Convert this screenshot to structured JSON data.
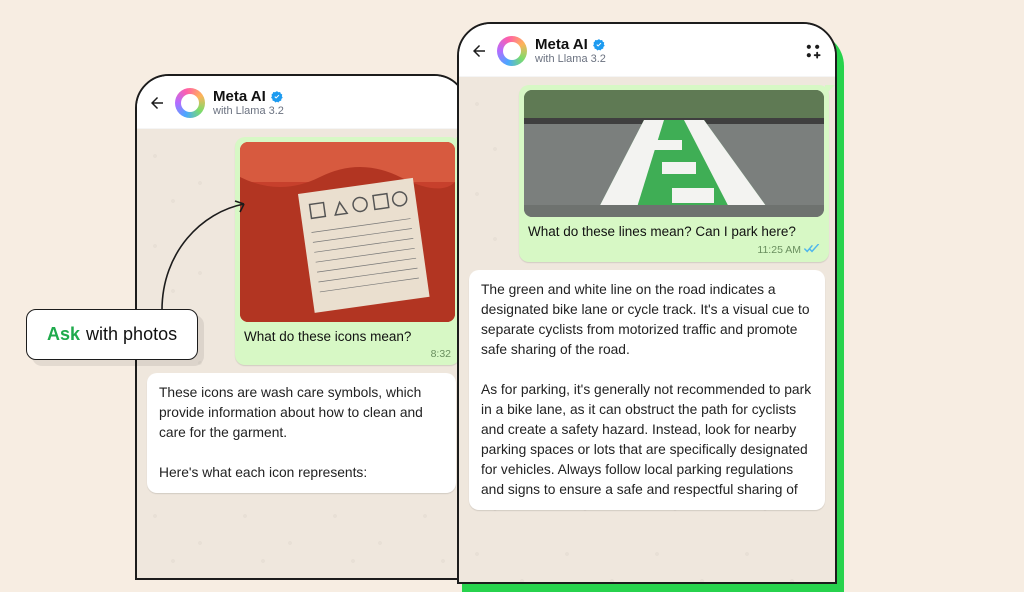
{
  "app": {
    "title": "Meta AI",
    "subtitle": "with Llama 3.2"
  },
  "callout": {
    "highlight": "Ask",
    "rest": " with photos"
  },
  "back_phone": {
    "user_caption": "What do these icons mean?",
    "user_time": "8:32",
    "ai_text": "These icons are wash care symbols, which provide information about how to clean and care for the garment.\n\nHere's what each icon represents:"
  },
  "front_phone": {
    "user_caption": "What do these lines mean? Can I park here?",
    "user_time": "11:25 AM",
    "ai_text": "The green and white line on the road indicates a designated bike lane or cycle track. It's a visual cue to separate cyclists from motorized traffic and promote safe sharing of the road.\n\nAs for parking, it's generally not recommended to park in a bike lane, as it can obstruct the path for cyclists and create a safety hazard. Instead, look for nearby parking spaces or lots that are specifically designated for vehicles. Always follow local parking regulations and signs to ensure a safe and respectful sharing of"
  }
}
